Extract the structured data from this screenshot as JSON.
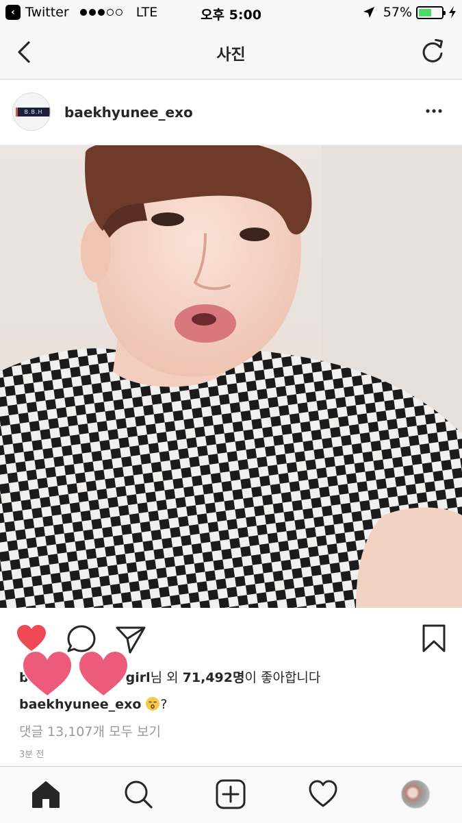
{
  "status_bar": {
    "back_app": "Twitter",
    "network": "LTE",
    "time": "오후 5:00",
    "battery_percent": "57%",
    "battery_level": 0.57
  },
  "nav": {
    "title": "사진"
  },
  "post": {
    "username": "baekhyunee_exo",
    "likes": {
      "prefix": "b",
      "name_tail": "girl",
      "suffix_1": "님 외 ",
      "count": "71,492명",
      "suffix_2": "이 좋아합니다"
    },
    "caption": {
      "username": "baekhyunee_exo",
      "text": "?"
    },
    "view_comments": "댓글 13,107개 모두 보기",
    "timestamp": "3분 전"
  },
  "colors": {
    "like_red": "#ed4956",
    "sticker_pink": "#ec5c7a",
    "muted_text": "#999999"
  },
  "icons": [
    "back-icon",
    "refresh-icon",
    "more-icon",
    "heart-filled-icon",
    "comment-icon",
    "share-icon",
    "bookmark-icon",
    "home-icon",
    "search-icon",
    "add-post-icon",
    "heart-outline-icon"
  ]
}
